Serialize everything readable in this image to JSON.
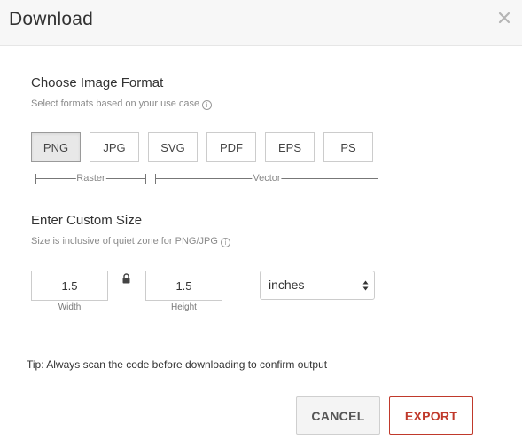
{
  "dialog": {
    "title": "Download",
    "close_icon": "close-icon"
  },
  "format_section": {
    "title": "Choose Image Format",
    "subtitle": "Select formats based on your use case",
    "info_icon": "info-icon",
    "formats": [
      "PNG",
      "JPG",
      "SVG",
      "PDF",
      "EPS",
      "PS"
    ],
    "selected": "PNG",
    "groups": {
      "raster": "Raster",
      "vector": "Vector"
    }
  },
  "size_section": {
    "title": "Enter Custom Size",
    "subtitle": "Size is inclusive of quiet zone for PNG/JPG",
    "info_icon": "info-icon",
    "width": {
      "value": "1.5",
      "caption": "Width"
    },
    "height": {
      "value": "1.5",
      "caption": "Height"
    },
    "lock_icon": "lock-icon",
    "unit": {
      "value": "inches",
      "icon": "select-arrows-icon"
    }
  },
  "tip": "Tip: Always scan the code before downloading to confirm output",
  "actions": {
    "cancel": "CANCEL",
    "export": "EXPORT",
    "export_color": "#c0392b"
  }
}
